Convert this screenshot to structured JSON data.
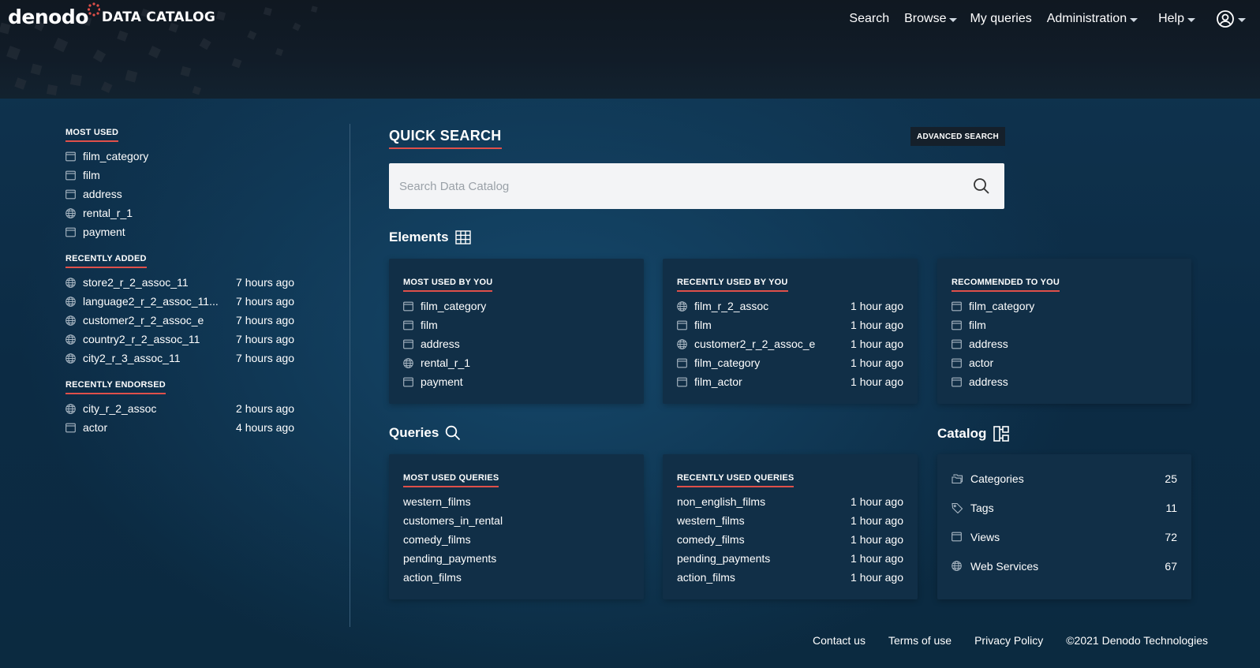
{
  "header": {
    "logo_word": "denodo",
    "product": "DATA CATALOG",
    "nav": [
      {
        "label": "Search",
        "dropdown": false
      },
      {
        "label": "Browse",
        "dropdown": true
      },
      {
        "label": "My queries",
        "dropdown": false
      },
      {
        "label": "Administration",
        "dropdown": true
      },
      {
        "label": "Help",
        "dropdown": true
      }
    ]
  },
  "sidebar": {
    "most_used": {
      "title": "MOST USED",
      "items": [
        {
          "name": "film_category",
          "icon": "view-icon"
        },
        {
          "name": "film",
          "icon": "view-icon"
        },
        {
          "name": "address",
          "icon": "view-icon"
        },
        {
          "name": "rental_r_1",
          "icon": "web-service-icon"
        },
        {
          "name": "payment",
          "icon": "view-icon"
        }
      ]
    },
    "recently_added": {
      "title": "RECENTLY ADDED",
      "items": [
        {
          "name": "store2_r_2_assoc_11",
          "time": "7 hours ago",
          "icon": "web-service-icon"
        },
        {
          "name": "language2_r_2_assoc_11...",
          "time": "7 hours ago",
          "icon": "web-service-icon"
        },
        {
          "name": "customer2_r_2_assoc_e",
          "time": "7 hours ago",
          "icon": "web-service-icon"
        },
        {
          "name": "country2_r_2_assoc_11",
          "time": "7 hours ago",
          "icon": "web-service-icon"
        },
        {
          "name": "city2_r_3_assoc_11",
          "time": "7 hours ago",
          "icon": "web-service-icon"
        }
      ]
    },
    "recently_endorsed": {
      "title": "RECENTLY ENDORSED",
      "items": [
        {
          "name": "city_r_2_assoc",
          "time": "2 hours ago",
          "icon": "web-service-icon"
        },
        {
          "name": "actor",
          "time": "4 hours ago",
          "icon": "view-icon"
        }
      ]
    }
  },
  "quick_search": {
    "title": "QUICK SEARCH",
    "advanced_label": "ADVANCED SEARCH",
    "placeholder": "Search Data Catalog"
  },
  "elements": {
    "title": "Elements",
    "most_used": {
      "title": "MOST USED BY YOU",
      "items": [
        {
          "name": "film_category",
          "icon": "view-icon"
        },
        {
          "name": "film",
          "icon": "view-icon"
        },
        {
          "name": "address",
          "icon": "view-icon"
        },
        {
          "name": "rental_r_1",
          "icon": "web-service-icon"
        },
        {
          "name": "payment",
          "icon": "view-icon"
        }
      ]
    },
    "recently_used": {
      "title": "RECENTLY USED BY YOU",
      "items": [
        {
          "name": "film_r_2_assoc",
          "time": "1 hour ago",
          "icon": "web-service-icon"
        },
        {
          "name": "film",
          "time": "1 hour ago",
          "icon": "view-icon"
        },
        {
          "name": "customer2_r_2_assoc_e",
          "time": "1 hour ago",
          "icon": "web-service-icon"
        },
        {
          "name": "film_category",
          "time": "1 hour ago",
          "icon": "view-icon"
        },
        {
          "name": "film_actor",
          "time": "1 hour ago",
          "icon": "view-icon"
        }
      ]
    },
    "recommended": {
      "title": "RECOMMENDED TO YOU",
      "items": [
        {
          "name": "film_category",
          "icon": "view-icon"
        },
        {
          "name": "film",
          "icon": "view-icon"
        },
        {
          "name": "address",
          "icon": "view-icon"
        },
        {
          "name": "actor",
          "icon": "view-icon"
        },
        {
          "name": "address",
          "icon": "view-icon"
        }
      ]
    }
  },
  "queries": {
    "title": "Queries",
    "most_used": {
      "title": "MOST USED QUERIES",
      "items": [
        "western_films",
        "customers_in_rental",
        "comedy_films",
        "pending_payments",
        "action_films"
      ]
    },
    "recently_used": {
      "title": "RECENTLY USED QUERIES",
      "items": [
        {
          "name": "non_english_films",
          "time": "1 hour ago"
        },
        {
          "name": "western_films",
          "time": "1 hour ago"
        },
        {
          "name": "comedy_films",
          "time": "1 hour ago"
        },
        {
          "name": "pending_payments",
          "time": "1 hour ago"
        },
        {
          "name": "action_films",
          "time": "1 hour ago"
        }
      ]
    }
  },
  "catalog": {
    "title": "Catalog",
    "items": [
      {
        "label": "Categories",
        "count": "25",
        "icon": "categories-icon"
      },
      {
        "label": "Tags",
        "count": "11",
        "icon": "tag-icon"
      },
      {
        "label": "Views",
        "count": "72",
        "icon": "view-icon"
      },
      {
        "label": "Web Services",
        "count": "67",
        "icon": "web-service-icon"
      }
    ]
  },
  "footer": {
    "links": [
      "Contact us",
      "Terms of use",
      "Privacy Policy"
    ],
    "copyright": "©2021 Denodo Technologies"
  },
  "colors": {
    "accent": "#e0504a",
    "header_bg": "#111c28",
    "body_bg": "#0f3450",
    "card_bg": "#112f47"
  }
}
